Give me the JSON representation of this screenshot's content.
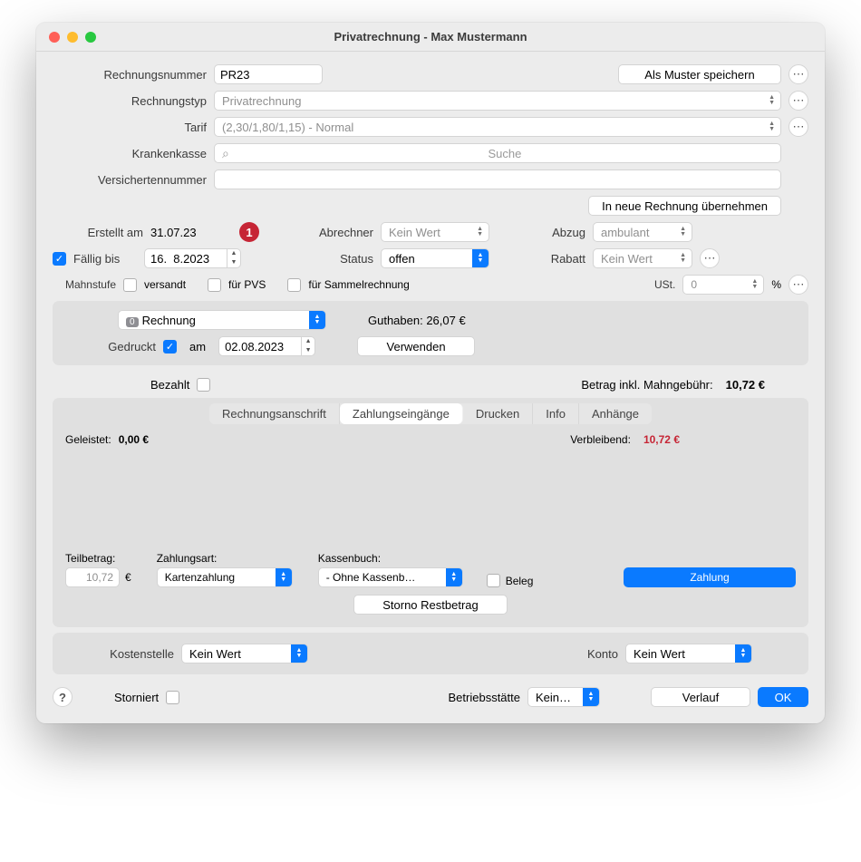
{
  "title": "Privatrechnung - Max Mustermann",
  "labels": {
    "rechnungsnummer": "Rechnungsnummer",
    "rechnungstyp": "Rechnungstyp",
    "tarif": "Tarif",
    "krankenkasse": "Krankenkasse",
    "versichertennummer": "Versichertennummer",
    "erstellt": "Erstellt am",
    "faellig": "Fällig bis",
    "abrechner": "Abrechner",
    "status": "Status",
    "abzug": "Abzug",
    "rabatt": "Rabatt",
    "ust": "USt.",
    "mahnstufe": "Mahnstufe",
    "versandt": "versandt",
    "fuerpvs": "für PVS",
    "sammel": "für Sammelrechnung",
    "gedruckt": "Gedruckt",
    "am": "am",
    "guthaben": "Guthaben: 26,07 €",
    "verwenden": "Verwenden",
    "bezahlt": "Bezahlt",
    "betrag_mahn": "Betrag inkl. Mahngebühr:",
    "geleistet": "Geleistet:",
    "verbleibend": "Verbleibend:",
    "teilbetrag": "Teilbetrag:",
    "zahlungsart": "Zahlungsart:",
    "kassenbuch": "Kassenbuch:",
    "beleg": "Beleg",
    "zahlung": "Zahlung",
    "storno_rest": "Storno Restbetrag",
    "kostenstelle": "Kostenstelle",
    "konto": "Konto",
    "storniert": "Storniert",
    "betriebs": "Betriebsstätte",
    "verlauf": "Verlauf",
    "ok": "OK",
    "percent": "%",
    "euro": "€"
  },
  "btns": {
    "muster": "Als Muster speichern",
    "neue": "In neue Rechnung übernehmen"
  },
  "tabs": {
    "anschrift": "Rechnungsanschrift",
    "zahlung": "Zahlungseingänge",
    "drucken": "Drucken",
    "info": "Info",
    "anhaenge": "Anhänge"
  },
  "values": {
    "rechnungsnummer": "PR23",
    "rechnungstyp": "Privatrechnung",
    "tarif": "(2,30/1,80/1,15) - Normal",
    "kk_placeholder": "Suche",
    "erstellt": "31.07.23",
    "faellig": "16.  8.2023",
    "badge": "1",
    "abrechner": "Kein Wert",
    "status": "offen",
    "abzug": "ambulant",
    "rabatt": "Kein Wert",
    "ust": "0",
    "mahnstufe_count": "0",
    "mahnstufe_sel": "Rechnung",
    "gedruckt_date": "02.08.2023",
    "betrag": "10,72 €",
    "geleistet": "0,00 €",
    "verbleibend": "10,72 €",
    "teilbetrag": "10,72",
    "zahlungsart": "Kartenzahlung",
    "kassenbuch": "- Ohne Kassenb…",
    "kostenstelle": "Kein Wert",
    "konto": "Kein Wert",
    "betriebs": "Kein…"
  }
}
